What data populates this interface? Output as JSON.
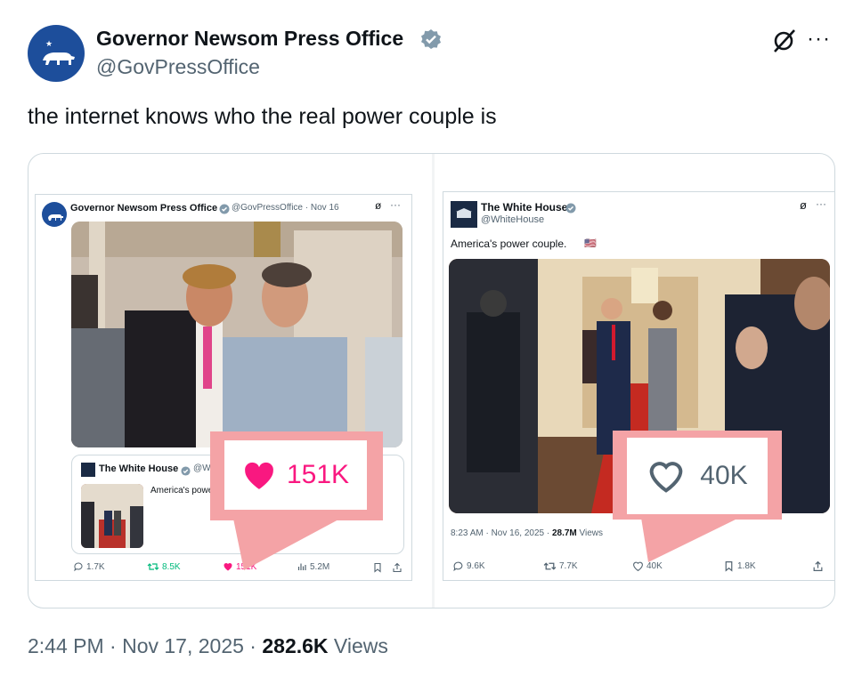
{
  "tweet": {
    "author_name": "Governor Newsom Press Office",
    "author_handle": "@GovPressOffice",
    "text": "the internet knows who the real power couple is",
    "timestamp": "2:44 PM · Nov 17, 2025 · ",
    "views_count": "282.6K",
    "views_label": " Views"
  },
  "left_shot": {
    "author_name": "Governor Newsom Press Office",
    "meta": "@GovPressOffice · Nov 16",
    "quote_name": "The White House",
    "quote_handle": "@Whit",
    "quote_text": "America's power",
    "like_callout": "151K",
    "actions": {
      "replies": "1.7K",
      "reposts": "8.5K",
      "likes": "151K",
      "views": "5.2M"
    }
  },
  "right_shot": {
    "author_name": "The White House",
    "author_handle": "@WhiteHouse",
    "text": "America's power couple.",
    "timestamp": "8:23 AM · Nov 16, 2025 · ",
    "views_count": "28.7M",
    "views_label": " Views",
    "like_callout": "40K",
    "actions": {
      "replies": "9.6K",
      "reposts": "7.7K",
      "likes": "40K",
      "bookmarks": "1.8K"
    }
  },
  "icons": [
    "grok-icon",
    "more-icon",
    "verified-badge-icon",
    "reply-icon",
    "repost-icon",
    "like-icon",
    "views-icon",
    "bookmark-icon",
    "share-icon"
  ],
  "colors": {
    "like_pink": "#f91880",
    "callout_pink": "#f4a3a6",
    "verified_gray": "#829aab",
    "repost_green": "#00ba7c",
    "muted": "#536471"
  }
}
